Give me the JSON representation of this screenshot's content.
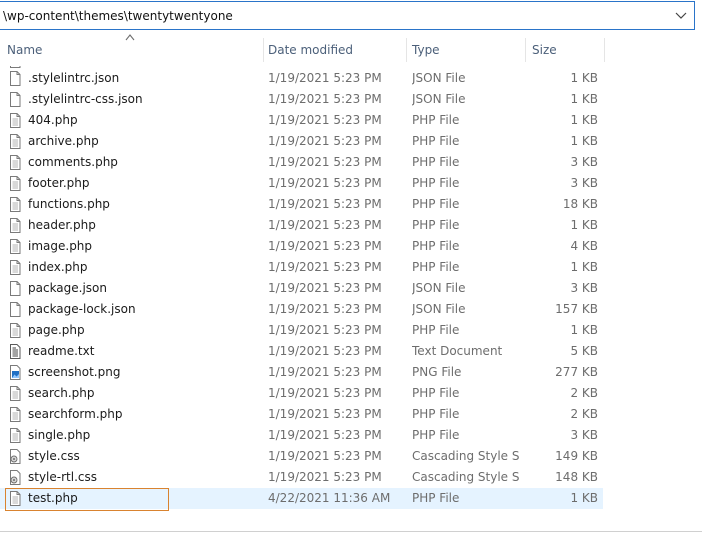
{
  "address_bar": {
    "path": "\\wp-content\\themes\\twentytwentyone"
  },
  "columns": {
    "name": "Name",
    "date_modified": "Date modified",
    "type": "Type",
    "size": "Size"
  },
  "files": [
    {
      "name": ".stylelintrc.json",
      "date": "1/19/2021 5:23 PM",
      "type": "JSON File",
      "size": "1 KB",
      "icon": "document-icon"
    },
    {
      "name": ".stylelintrc-css.json",
      "date": "1/19/2021 5:23 PM",
      "type": "JSON File",
      "size": "1 KB",
      "icon": "document-icon"
    },
    {
      "name": "404.php",
      "date": "1/19/2021 5:23 PM",
      "type": "PHP File",
      "size": "1 KB",
      "icon": "text-file-icon"
    },
    {
      "name": "archive.php",
      "date": "1/19/2021 5:23 PM",
      "type": "PHP File",
      "size": "1 KB",
      "icon": "text-file-icon"
    },
    {
      "name": "comments.php",
      "date": "1/19/2021 5:23 PM",
      "type": "PHP File",
      "size": "3 KB",
      "icon": "text-file-icon"
    },
    {
      "name": "footer.php",
      "date": "1/19/2021 5:23 PM",
      "type": "PHP File",
      "size": "3 KB",
      "icon": "text-file-icon"
    },
    {
      "name": "functions.php",
      "date": "1/19/2021 5:23 PM",
      "type": "PHP File",
      "size": "18 KB",
      "icon": "text-file-icon"
    },
    {
      "name": "header.php",
      "date": "1/19/2021 5:23 PM",
      "type": "PHP File",
      "size": "1 KB",
      "icon": "text-file-icon"
    },
    {
      "name": "image.php",
      "date": "1/19/2021 5:23 PM",
      "type": "PHP File",
      "size": "4 KB",
      "icon": "text-file-icon"
    },
    {
      "name": "index.php",
      "date": "1/19/2021 5:23 PM",
      "type": "PHP File",
      "size": "1 KB",
      "icon": "text-file-icon"
    },
    {
      "name": "package.json",
      "date": "1/19/2021 5:23 PM",
      "type": "JSON File",
      "size": "3 KB",
      "icon": "document-icon"
    },
    {
      "name": "package-lock.json",
      "date": "1/19/2021 5:23 PM",
      "type": "JSON File",
      "size": "157 KB",
      "icon": "document-icon"
    },
    {
      "name": "page.php",
      "date": "1/19/2021 5:23 PM",
      "type": "PHP File",
      "size": "1 KB",
      "icon": "text-file-icon"
    },
    {
      "name": "readme.txt",
      "date": "1/19/2021 5:23 PM",
      "type": "Text Document",
      "size": "5 KB",
      "icon": "text-document-icon"
    },
    {
      "name": "screenshot.png",
      "date": "1/19/2021 5:23 PM",
      "type": "PNG File",
      "size": "277 KB",
      "icon": "image-file-icon"
    },
    {
      "name": "search.php",
      "date": "1/19/2021 5:23 PM",
      "type": "PHP File",
      "size": "2 KB",
      "icon": "text-file-icon"
    },
    {
      "name": "searchform.php",
      "date": "1/19/2021 5:23 PM",
      "type": "PHP File",
      "size": "2 KB",
      "icon": "text-file-icon"
    },
    {
      "name": "single.php",
      "date": "1/19/2021 5:23 PM",
      "type": "PHP File",
      "size": "3 KB",
      "icon": "text-file-icon"
    },
    {
      "name": "style.css",
      "date": "1/19/2021 5:23 PM",
      "type": "Cascading Style S...",
      "size": "149 KB",
      "icon": "css-file-icon"
    },
    {
      "name": "style-rtl.css",
      "date": "1/19/2021 5:23 PM",
      "type": "Cascading Style S...",
      "size": "148 KB",
      "icon": "css-file-icon"
    },
    {
      "name": "test.php",
      "date": "4/22/2021 11:36 AM",
      "type": "PHP File",
      "size": "1 KB",
      "icon": "text-file-icon",
      "selected": true
    }
  ]
}
